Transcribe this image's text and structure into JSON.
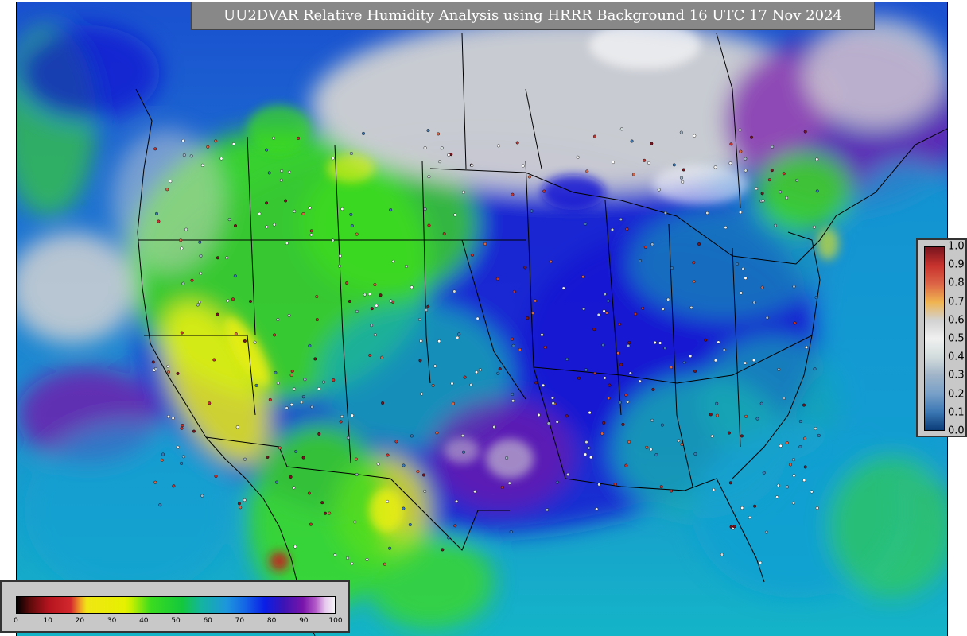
{
  "title": "UU2DVAR Relative Humidity Analysis using HRRR Background 16 UTC 17 Nov 2024",
  "background_colorbar": {
    "ticks": [
      "0",
      "10",
      "20",
      "30",
      "40",
      "50",
      "60",
      "70",
      "80",
      "90",
      "100"
    ],
    "stops": [
      {
        "value": 0,
        "color": "#000000"
      },
      {
        "value": 4,
        "color": "#5a0a0a"
      },
      {
        "value": 10,
        "color": "#b4141e"
      },
      {
        "value": 17,
        "color": "#d2282d"
      },
      {
        "value": 20,
        "color": "#f0a028"
      },
      {
        "value": 22,
        "color": "#f0e614"
      },
      {
        "value": 34,
        "color": "#e6f000"
      },
      {
        "value": 36,
        "color": "#c8f000"
      },
      {
        "value": 42,
        "color": "#3cdc1e"
      },
      {
        "value": 52,
        "color": "#14c83c"
      },
      {
        "value": 58,
        "color": "#14b4a0"
      },
      {
        "value": 66,
        "color": "#1e96dc"
      },
      {
        "value": 72,
        "color": "#1464e6"
      },
      {
        "value": 78,
        "color": "#0a1ee6"
      },
      {
        "value": 84,
        "color": "#3c14b4"
      },
      {
        "value": 90,
        "color": "#7814aa"
      },
      {
        "value": 94,
        "color": "#b45ac8"
      },
      {
        "value": 97,
        "color": "#e6c8ee"
      },
      {
        "value": 100,
        "color": "#f5f5f5"
      }
    ]
  },
  "observation_colorbar": {
    "ticks": [
      "0.0",
      "0.1",
      "0.2",
      "0.3",
      "0.4",
      "0.5",
      "0.6",
      "0.7",
      "0.8",
      "0.9",
      "1.0"
    ],
    "stops": [
      {
        "value": 0.0,
        "color": "#0a3c78"
      },
      {
        "value": 0.1,
        "color": "#3c78b4"
      },
      {
        "value": 0.2,
        "color": "#78a0c8"
      },
      {
        "value": 0.3,
        "color": "#a0b4c8"
      },
      {
        "value": 0.4,
        "color": "#d2dcdc"
      },
      {
        "value": 0.5,
        "color": "#f0f0f0"
      },
      {
        "value": 0.6,
        "color": "#d2d2d2"
      },
      {
        "value": 0.7,
        "color": "#f0b450"
      },
      {
        "value": 0.8,
        "color": "#dc6446"
      },
      {
        "value": 0.9,
        "color": "#c8322d"
      },
      {
        "value": 1.0,
        "color": "#78141e"
      }
    ]
  },
  "field_colors": {
    "ocean": "#2a6cc8",
    "ocean_deep": "#1414d2",
    "ocean_cyan": "#14a0d2",
    "dry_yellow": "#f0f014",
    "green": "#3cdc1e",
    "teal": "#14aab4",
    "purple": "#7814aa",
    "saturated": "#d2d2d2",
    "boundary": "#000000"
  }
}
